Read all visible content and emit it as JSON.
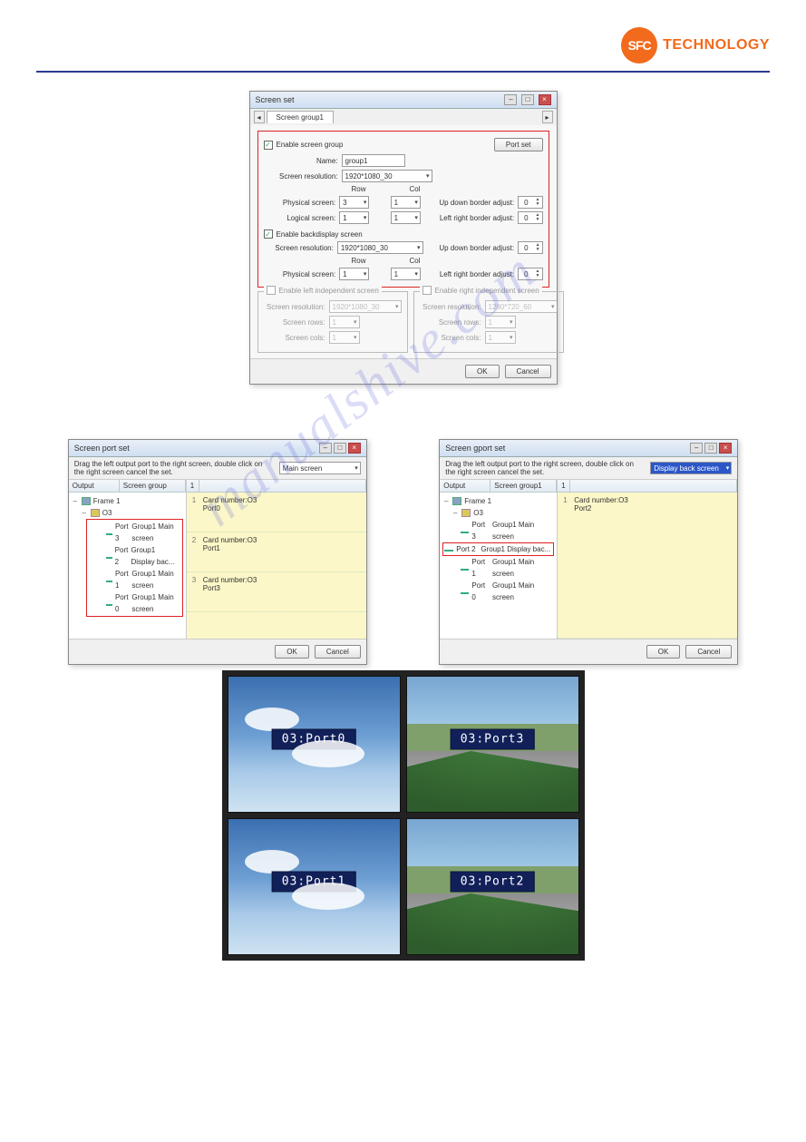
{
  "header": {
    "logo_badge": "SFC",
    "logo_text": "TECHNOLOGY"
  },
  "watermark": "manualshive.com",
  "screen_set": {
    "title": "Screen set",
    "tab_label": "Screen group1",
    "enable_group_label": "Enable screen group",
    "portset_btn": "Port set",
    "name_label": "Name:",
    "name_value": "group1",
    "screen_res_label": "Screen resolution:",
    "screen_res_value": "1920*1080_30",
    "row_label": "Row",
    "col_label": "Col",
    "physical_label": "Physical screen:",
    "physical_row": "3",
    "physical_col": "1",
    "logical_label": "Logical screen:",
    "logical_row": "1",
    "logical_col": "1",
    "ud_border_label": "Up down border adjust:",
    "ud_border_value": "0",
    "lr_border_label": "Left right border adjust:",
    "lr_border_value": "0",
    "enable_back_label": "Enable backdisplay screen",
    "back_res_value": "1920*1080_30",
    "back_phys_row": "1",
    "back_phys_col": "1",
    "back_ud_value": "0",
    "back_lr_value": "0",
    "enable_left_label": "Enable left independent screen",
    "enable_right_label": "Enable right independent screen",
    "ind_res_label": "Screen resolution:",
    "left_res": "1920*1080_30",
    "right_res": "1280*720_60",
    "ind_rows_label": "Screen rows:",
    "ind_cols_label": "Screen cols:",
    "ind_val": "1",
    "ok_btn": "OK",
    "cancel_btn": "Cancel"
  },
  "port_left": {
    "title": "Screen port set",
    "instruction": "Drag the left output port to the right screen, double click on the right screen cancel the set.",
    "dropdown_label": "Main screen",
    "th_output": "Output",
    "th_group": "Screen group",
    "tree": {
      "frame": "Frame 1",
      "card": "O3",
      "ports": [
        {
          "p": "Port 3",
          "g": "Group1 Main screen"
        },
        {
          "p": "Port 2",
          "g": "Group1 Display bac..."
        },
        {
          "p": "Port 1",
          "g": "Group1 Main screen"
        },
        {
          "p": "Port 0",
          "g": "Group1 Main screen"
        }
      ]
    },
    "panels": [
      {
        "n": "1",
        "l1": "Card number:O3",
        "l2": "Port0"
      },
      {
        "n": "2",
        "l1": "Card number:O3",
        "l2": "Port1"
      },
      {
        "n": "3",
        "l1": "Card number:O3",
        "l2": "Port3"
      }
    ],
    "ok": "OK",
    "cancel": "Cancel"
  },
  "port_right": {
    "title": "Screen gport set",
    "instruction": "Drag the left output port to the right screen, double click on the right screen cancel the set.",
    "dropdown_label": "Display  back screen",
    "th_output": "Output",
    "th_group": "Screen group1",
    "tree": {
      "frame": "Frame 1",
      "card": "O3",
      "ports": [
        {
          "p": "Port 3",
          "g": "Group1 Main screen"
        },
        {
          "p": "Port 2",
          "g": "Group1 Display bac..."
        },
        {
          "p": "Port 1",
          "g": "Group1 Main screen"
        },
        {
          "p": "Port 0",
          "g": "Group1 Main screen"
        }
      ]
    },
    "panels": [
      {
        "n": "1",
        "l1": "Card number:O3",
        "l2": "Port2"
      }
    ],
    "ok": "OK",
    "cancel": "Cancel"
  },
  "videowall": {
    "tl": "03:Port0",
    "tr": "03:Port3",
    "bl": "03:Port1",
    "br": "03:Port2"
  }
}
